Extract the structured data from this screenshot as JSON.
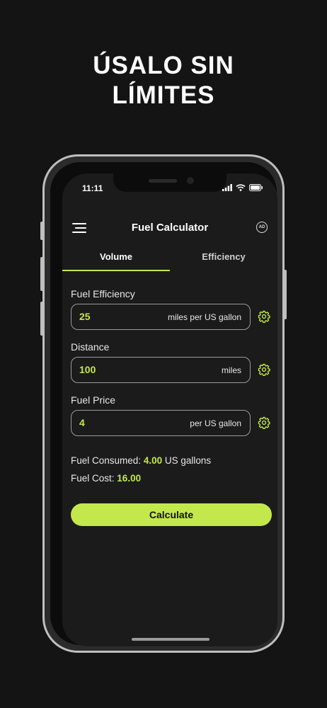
{
  "headline": {
    "line1": "ÚSALO SIN",
    "line2": "LÍMITES"
  },
  "status_bar": {
    "time": "11:11"
  },
  "app": {
    "title": "Fuel Calculator",
    "ad_badge": "AD",
    "accent_color": "#c3e84b"
  },
  "tabs": [
    {
      "label": "Volume",
      "active": true
    },
    {
      "label": "Efficiency",
      "active": false
    }
  ],
  "fields": [
    {
      "label": "Fuel Efficiency",
      "value": "25",
      "unit": "miles per US gallon"
    },
    {
      "label": "Distance",
      "value": "100",
      "unit": "miles"
    },
    {
      "label": "Fuel Price",
      "value": "4",
      "unit": "per US gallon"
    }
  ],
  "results": {
    "consumed_label": "Fuel Consumed:",
    "consumed_value": "4.00",
    "consumed_unit": "US gallons",
    "cost_label": "Fuel Cost:",
    "cost_value": "16.00"
  },
  "calculate_label": "Calculate",
  "icons": [
    "menu-icon",
    "ad-icon",
    "gear-icon",
    "signal-icon",
    "wifi-icon",
    "battery-icon"
  ]
}
